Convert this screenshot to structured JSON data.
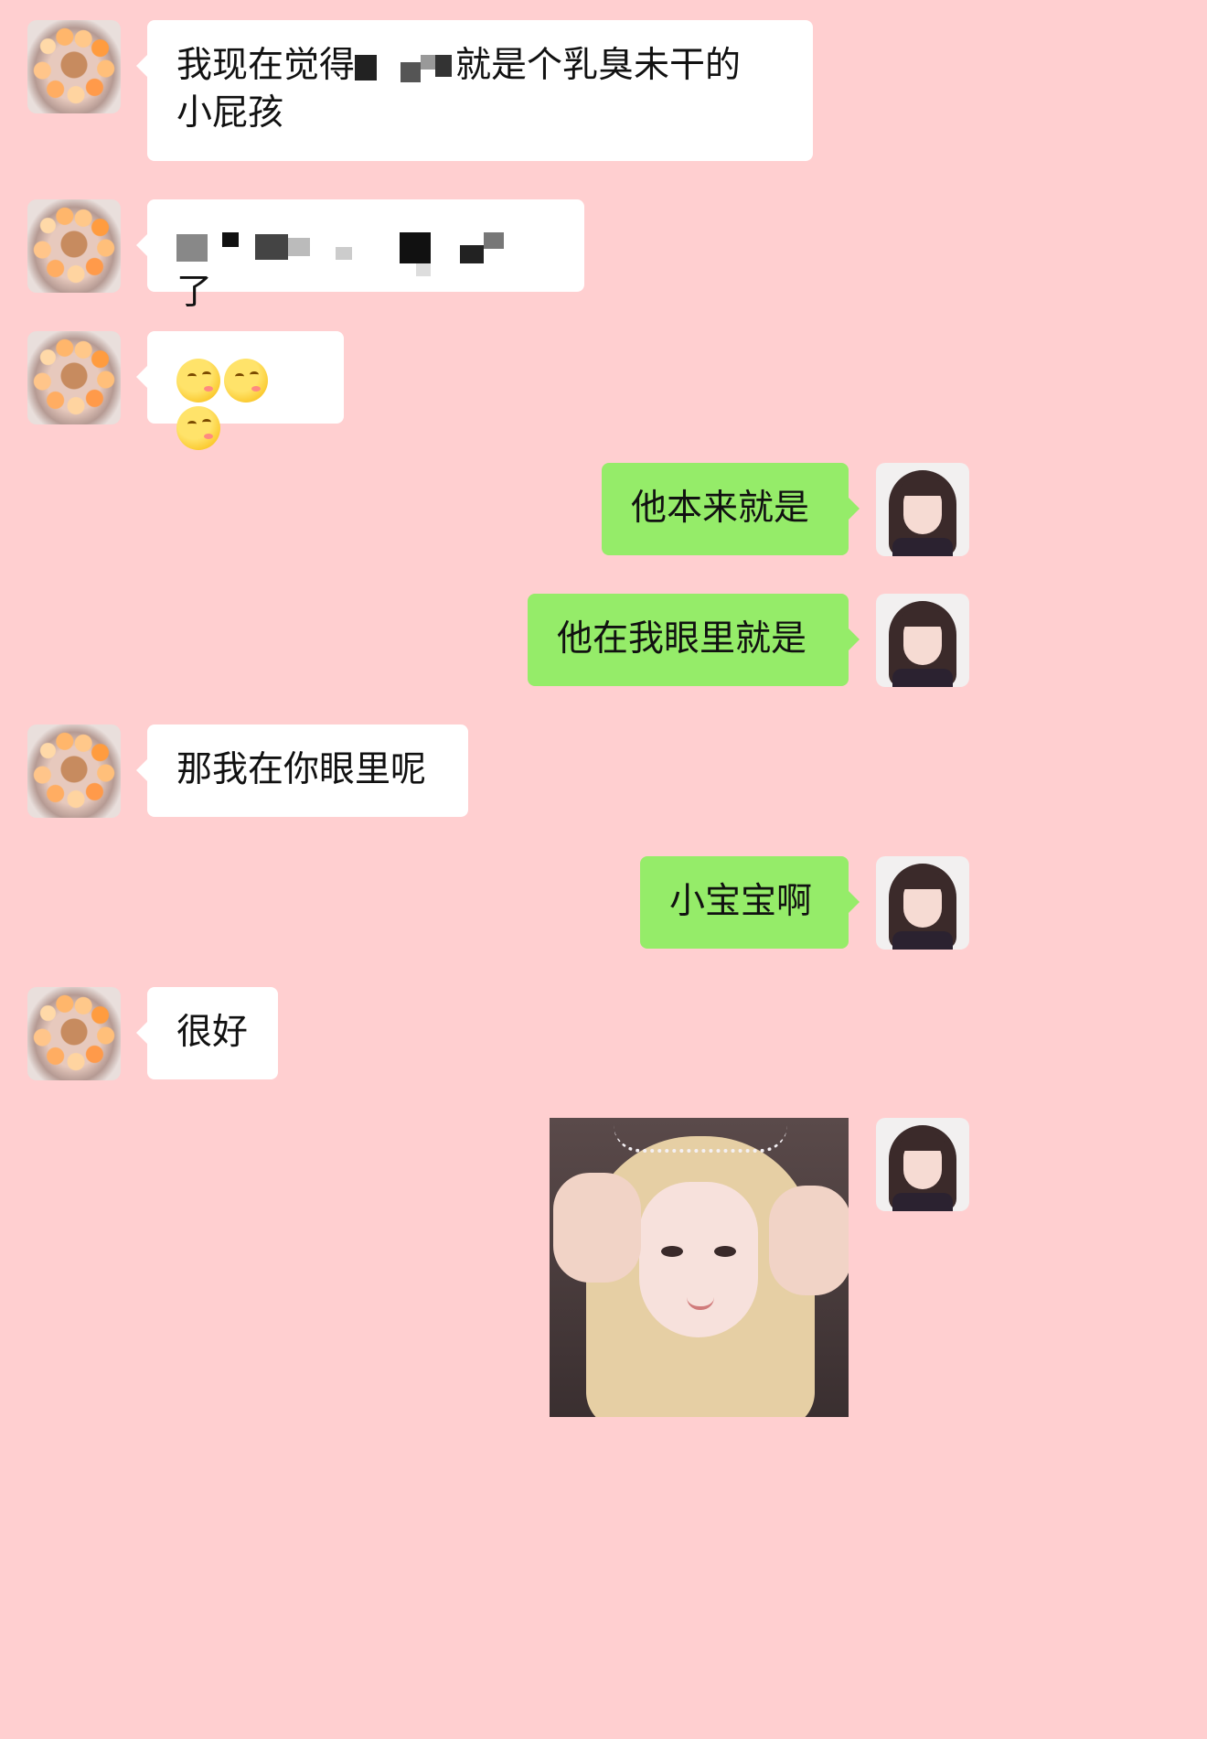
{
  "chat": {
    "messages": [
      {
        "from": "contact",
        "text_before": "我现在觉得",
        "redacted": true,
        "text_after": "就是个乳臭未干的",
        "line2": "小屁孩"
      },
      {
        "from": "contact",
        "redacted": true,
        "text_after": "了"
      },
      {
        "from": "contact",
        "emoji": [
          "smirk-emoji",
          "smirk-emoji",
          "smirk-emoji"
        ]
      },
      {
        "from": "me",
        "text": "他本来就是"
      },
      {
        "from": "me",
        "text": "他在我眼里就是"
      },
      {
        "from": "contact",
        "text": "那我在你眼里呢"
      },
      {
        "from": "me",
        "text": "小宝宝啊"
      },
      {
        "from": "contact",
        "text": "很好"
      },
      {
        "from": "me",
        "image": "selfie-photo"
      }
    ]
  },
  "colors": {
    "background": "#ffcfd0",
    "incoming_bubble": "#ffffff",
    "outgoing_bubble": "#95ec69"
  }
}
